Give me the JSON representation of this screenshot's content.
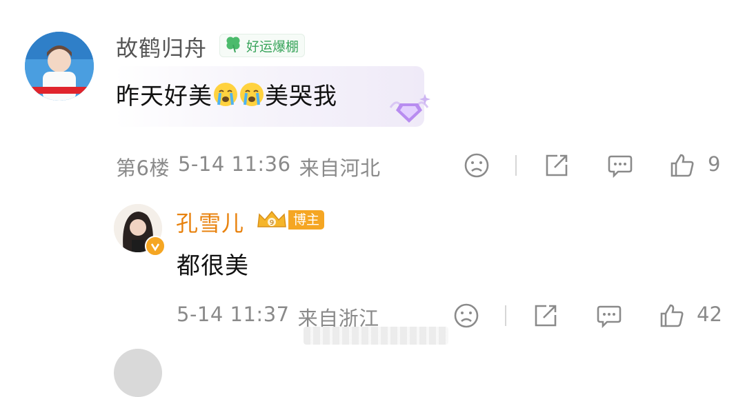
{
  "comment1": {
    "username": "故鹤归舟",
    "badge_text": "好运爆棚",
    "text": "昨天好美",
    "text_suffix": "美哭我",
    "emojis": [
      "crying-emoji",
      "crying-emoji"
    ],
    "floor": "第6楼",
    "timestamp": "5-14 11:36",
    "location": "来自河北",
    "like_count": "9"
  },
  "reply1": {
    "username": "孔雪儿",
    "badge_text": "博主",
    "text": "都很美",
    "timestamp": "5-14 11:37",
    "location": "来自浙江",
    "like_count": "42"
  },
  "colors": {
    "username_gray": "#555555",
    "author_orange": "#e8820e",
    "lucky_green": "#3aa55c",
    "meta_gray": "#8a8a8a"
  }
}
